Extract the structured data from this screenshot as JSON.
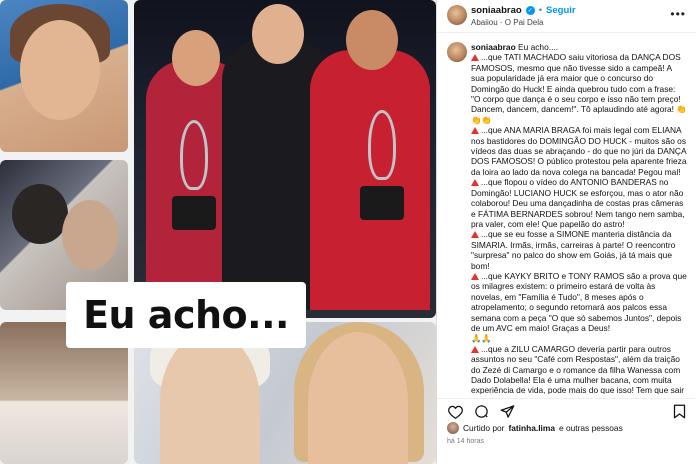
{
  "post": {
    "username": "soniaabrao",
    "follow_label": "Seguir",
    "dot": "•",
    "audio": "Abaiiou · O Pai Dela",
    "overlay_text": "Eu acho..."
  },
  "caption": {
    "intro": "Eu acho....",
    "paragraphs": [
      "...que TATI MACHADO saiu vitoriosa da DANÇA DOS FAMOSOS, mesmo que não tivesse sido a campeã! A sua popularidade já era maior que o concurso do Domingão do Huck! E ainda quebrou tudo com a frase: \"O corpo que dança é o seu corpo e isso não tem preço! Dancem, dancem, dancem!\". Tô aplaudindo até agora! 👏👏👏",
      "...que ANA MARIA BRAGA foi mais legal com ELIANA nos bastidores do DOMINGÃO DO HUCK - muitos são os vídeos das duas se abraçando - do que no júri da DANÇA DOS FAMOSOS! O público protestou pela aparente frieza da loira ao lado da nova colega na bancada! Pegou mal!",
      "...que flopou o vídeo do ANTONIO BANDERAS no Domingão! LUCIANO HUCK se esforçou, mas o ator não colaborou! Deu uma dançadinha de costas pras câmeras e FÁTIMA BERNARDES sobrou! Nem tango nem samba, pra valer, com ele! Que papelão do astro!",
      "...que se eu fosse a SIMONE manteria distância da SIMARIA. Irmãs, irmãs, carreiras à parte! O reencontro \"surpresa\" no palco do show em Goiás, já tá mais que bom!",
      "...que KAYKY BRITO e TONY RAMOS são a prova que os milagres existem: o primeiro estará de volta às novelas, em \"Família é Tudo\", 8 meses após o atropelamento; o segundo retornará aos palcos essa semana com a peça \"O que só sabemos Juntos\", depois de um AVC em maio! Graças a Deus!",
      "🙏🙏",
      "...que a ZILU CAMARGO deveria partir para outros assuntos no seu \"Café com Respostas\", além da traição do Zezé di Camargo e o romance da filha Wanessa com Dado Dolabella! Ela é uma mulher bacana, com muita experiência de vida, pode mais do que isso! Tem que sair dessa bolha familiar! Hora de virar a página!",
      "...que Bruna Biancardi voltar com Neymar pode até ser um direito dela, mas devia prestar atenção no velho ditado: \"Errar é humano, errar duas vezes é burrice\". Né?"
    ],
    "warn_flags": [
      true,
      true,
      true,
      true,
      true,
      false,
      true,
      true
    ]
  },
  "actions": {
    "like_icon": "heart-icon",
    "comment_icon": "comment-icon",
    "share_icon": "send-icon",
    "save_icon": "bookmark-icon"
  },
  "likes": {
    "prefix": "Curtido por",
    "user": "fatinha.lima",
    "suffix": "e outras pessoas"
  },
  "time": "há 14 horas",
  "colors": {
    "accent": "#0095f6",
    "warning": "#e3342f",
    "dance_red": "#c72030"
  }
}
